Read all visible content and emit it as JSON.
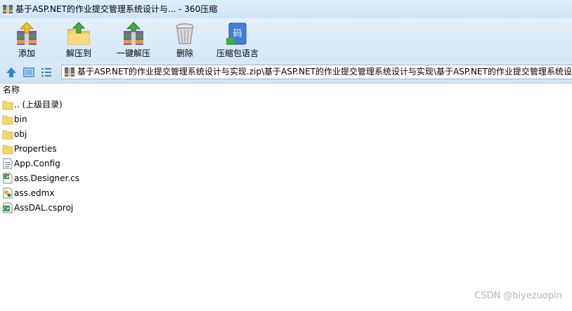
{
  "window": {
    "title": "基于ASP.NET的作业提交管理系统设计与... - 360压缩"
  },
  "toolbar": {
    "items": [
      {
        "label": "添加",
        "icon": "add-books-icon"
      },
      {
        "label": "解压到",
        "icon": "extract-folder-icon"
      },
      {
        "label": "一键解压",
        "icon": "one-click-extract-icon"
      },
      {
        "label": "删除",
        "icon": "trash-can-icon"
      },
      {
        "label": "压缩包语言",
        "icon": "archive-language-icon"
      }
    ]
  },
  "address": {
    "path": "基于ASP.NET的作业提交管理系统设计与实现.zip\\基于ASP.NET的作业提交管理系统设计与实现\\基于ASP.NET的作业提交管理系统设计与实现"
  },
  "list": {
    "column_name": "名称",
    "items": [
      {
        "name": ".. (上级目录)",
        "icon": "folder-icon"
      },
      {
        "name": "bin",
        "icon": "folder-icon"
      },
      {
        "name": "obj",
        "icon": "folder-icon"
      },
      {
        "name": "Properties",
        "icon": "folder-icon"
      },
      {
        "name": "App.Config",
        "icon": "config-file-icon"
      },
      {
        "name": "ass.Designer.cs",
        "icon": "csharp-file-icon"
      },
      {
        "name": "ass.edmx",
        "icon": "edmx-file-icon"
      },
      {
        "name": "AssDAL.csproj",
        "icon": "csproj-file-icon"
      }
    ]
  },
  "watermark": "CSDN @biyezuopin"
}
